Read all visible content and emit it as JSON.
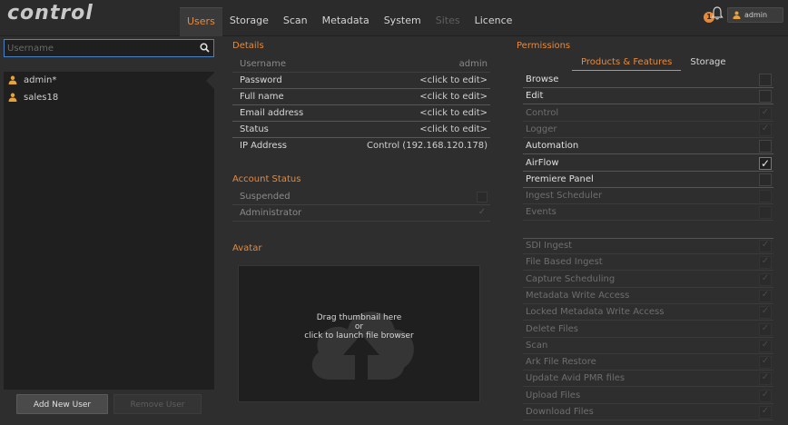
{
  "app": {
    "logo": "control"
  },
  "nav": {
    "tabs": [
      {
        "label": "Users",
        "active": true
      },
      {
        "label": "Storage"
      },
      {
        "label": "Scan"
      },
      {
        "label": "Metadata"
      },
      {
        "label": "System"
      },
      {
        "label": "Sites",
        "disabled": true
      },
      {
        "label": "Licence"
      }
    ],
    "notification_count": "1",
    "current_user": "admin"
  },
  "search": {
    "placeholder": "Username",
    "value": ""
  },
  "users": [
    {
      "name": "admin*"
    },
    {
      "name": "sales18"
    }
  ],
  "buttons": {
    "add_user": "Add New User",
    "remove_user": "Remove User"
  },
  "details": {
    "title": "Details",
    "fields": [
      {
        "label": "Username",
        "value": "admin"
      },
      {
        "label": "Password",
        "value": "<click to edit>"
      },
      {
        "label": "Full name",
        "value": "<click to edit>"
      },
      {
        "label": "Email address",
        "value": "<click to edit>"
      },
      {
        "label": "Status",
        "value": "<click to edit>"
      },
      {
        "label": "IP Address",
        "value": "Control (192.168.120.178)"
      }
    ]
  },
  "account_status": {
    "title": "Account Status",
    "items": [
      {
        "label": "Suspended",
        "checked": false
      },
      {
        "label": "Administrator",
        "checked": true
      }
    ]
  },
  "avatar": {
    "title": "Avatar",
    "drop_text_1": "Drag thumbnail here",
    "drop_text_2": "or",
    "drop_text_3": "click to launch file browser"
  },
  "permissions": {
    "title": "Permissions",
    "tabs": [
      {
        "label": "Products & Features",
        "active": true
      },
      {
        "label": "Storage"
      }
    ],
    "group1": [
      {
        "label": "Browse",
        "enabled": true,
        "checked": false
      },
      {
        "label": "Edit",
        "enabled": true,
        "checked": false
      },
      {
        "label": "Control",
        "enabled": false,
        "checked": true
      },
      {
        "label": "Logger",
        "enabled": false,
        "checked": true
      },
      {
        "label": "Automation",
        "enabled": true,
        "checked": false
      },
      {
        "label": "AirFlow",
        "enabled": true,
        "checked": true
      },
      {
        "label": "Premiere Panel",
        "enabled": true,
        "checked": false
      },
      {
        "label": "Ingest Scheduler",
        "enabled": false,
        "checked": false
      },
      {
        "label": "Events",
        "enabled": false,
        "checked": false
      }
    ],
    "group2": [
      {
        "label": "SDI Ingest",
        "checked": true
      },
      {
        "label": "File Based Ingest",
        "checked": true
      },
      {
        "label": "Capture Scheduling",
        "checked": true
      },
      {
        "label": "Metadata Write Access",
        "checked": true
      },
      {
        "label": "Locked Metadata Write Access",
        "checked": true
      },
      {
        "label": "Delete Files",
        "checked": true
      },
      {
        "label": "Scan",
        "checked": true
      },
      {
        "label": "Ark File Restore",
        "checked": true
      },
      {
        "label": "Update Avid PMR files",
        "checked": true
      },
      {
        "label": "Upload Files",
        "checked": true
      },
      {
        "label": "Download Files",
        "checked": true
      }
    ]
  },
  "colors": {
    "accent": "#e8893a",
    "focus": "#4a82c4",
    "background": "#2e2e2e",
    "panel": "#1f1f1f"
  },
  "icons": {
    "search": "magnifier-icon",
    "bell": "bell-icon",
    "user": "person-icon"
  }
}
